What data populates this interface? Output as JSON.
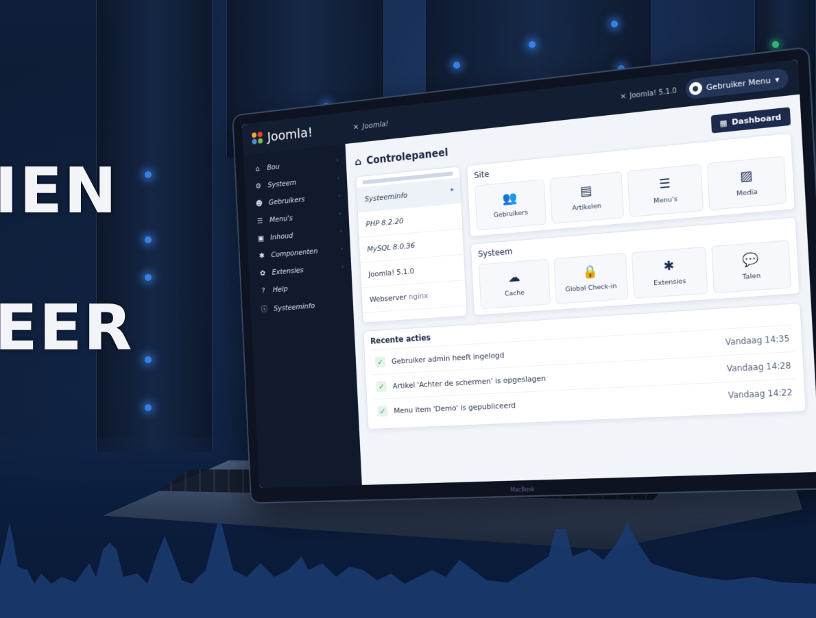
{
  "hero": {
    "line1": "IEN",
    "line2": "EER"
  },
  "app": {
    "logo_text": "Joomla!",
    "site_link": "Joomla!",
    "version": "Joomla! 5.1.0",
    "user_menu": "Gebruiker Menu",
    "dashboard_button": "Dashboard",
    "bezel_label": "MacBook"
  },
  "sidebar": {
    "items": [
      {
        "label": "Bou",
        "icon": "home-icon"
      },
      {
        "label": "Systeem",
        "icon": "wrench-icon"
      },
      {
        "label": "Gebruikers",
        "icon": "users-icon"
      },
      {
        "label": "Menu's",
        "icon": "list-icon"
      },
      {
        "label": "Inhoud",
        "icon": "file-icon"
      },
      {
        "label": "Componenten",
        "icon": "puzzle-icon"
      },
      {
        "label": "Extensies",
        "icon": "extension-icon"
      },
      {
        "label": "Help",
        "icon": "help-icon"
      },
      {
        "label": "Systeeminfo",
        "icon": "info-icon"
      }
    ]
  },
  "main": {
    "page_title": "Controlepaneel",
    "info": {
      "systeeminfo": "Systeeminfo",
      "php": "PHP 8.2.20",
      "mysql": "MySQL 8.0.36",
      "joomla": "Joomla! 5.1.0",
      "webserver_label": "Webserver",
      "webserver_value": "nginx"
    },
    "site_panel": {
      "title": "Site",
      "tiles": [
        {
          "label": "Gebruikers",
          "icon": "users-icon"
        },
        {
          "label": "Artikelen",
          "icon": "article-icon"
        },
        {
          "label": "Menu's",
          "icon": "menu-list-icon"
        },
        {
          "label": "Media",
          "icon": "image-icon"
        }
      ]
    },
    "system_panel": {
      "title": "Systeem",
      "tiles": [
        {
          "label": "Cache",
          "icon": "cache-icon"
        },
        {
          "label": "Global Check-in",
          "icon": "lock-icon"
        },
        {
          "label": "Extensies",
          "icon": "puzzle-icon"
        },
        {
          "label": "Talen",
          "icon": "language-icon"
        }
      ]
    },
    "recent": {
      "title": "Recente acties",
      "items": [
        {
          "text": "Gebruiker admin heeft ingelogd",
          "time": "Vandaag 14:35"
        },
        {
          "text": "Artikel 'Achter de schermen' is opgeslagen",
          "time": "Vandaag 14:28"
        },
        {
          "text": "Menu item 'Demo' is gepubliceerd",
          "time": "Vandaag 14:22"
        }
      ]
    }
  }
}
